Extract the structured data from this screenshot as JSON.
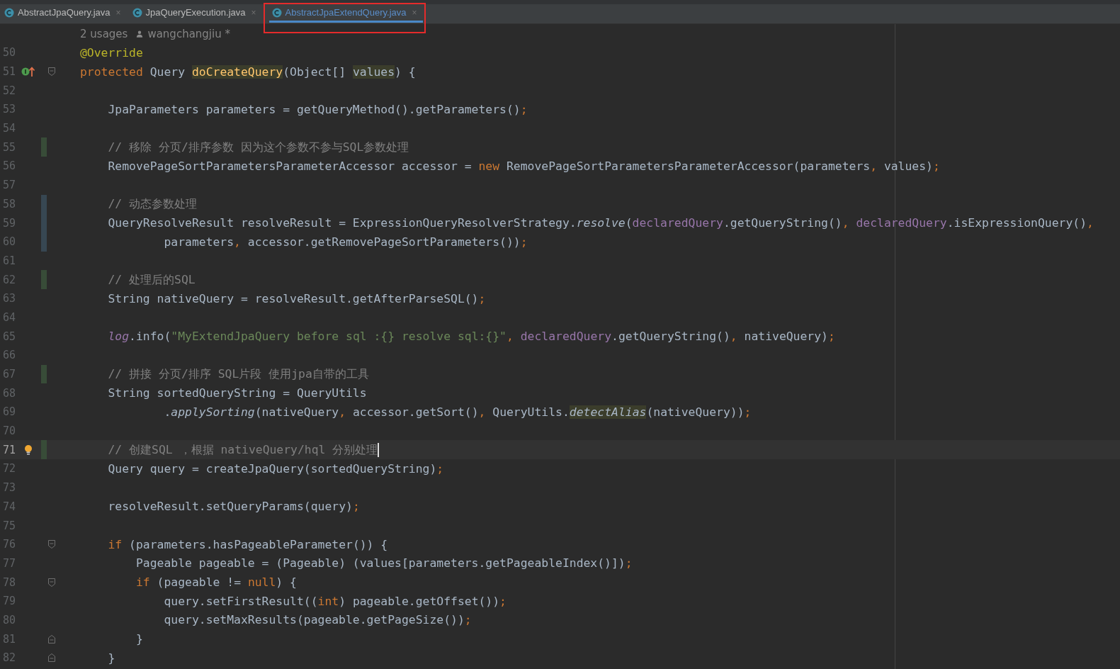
{
  "tabs": [
    {
      "label": "AbstractJpaQuery.java",
      "close": "×",
      "selected": false,
      "annotated": false
    },
    {
      "label": "JpaQueryExecution.java",
      "close": "×",
      "selected": false,
      "annotated": false
    },
    {
      "label": "AbstractJpaExtendQuery.java",
      "close": "×",
      "selected": true,
      "annotated": true
    }
  ],
  "editor": {
    "inlay": {
      "usages": "2 usages",
      "author": "wangchangjiu *"
    },
    "lines": [
      {
        "number": "50",
        "current": false,
        "tokens": [
          {
            "text": "@Override",
            "kind": "ann"
          }
        ]
      },
      {
        "number": "51",
        "current": false,
        "gutter_icon": {
          "kind": "override"
        },
        "fold": {
          "kind": "start"
        },
        "tokens": [
          {
            "text": "protected",
            "kind": "kw"
          },
          {
            "text": " Query ",
            "kind": "plain"
          },
          {
            "text": "doCreateQuery",
            "kind": "decl-hl"
          },
          {
            "text": "(Object[] ",
            "kind": "plain"
          },
          {
            "text": "values",
            "kind": "param-hl"
          },
          {
            "text": ") {",
            "kind": "plain"
          }
        ]
      },
      {
        "number": "52",
        "current": false
      },
      {
        "number": "53",
        "current": false,
        "tokens": [
          {
            "text": "    JpaParameters parameters = getQueryMethod().getParameters()",
            "kind": "plain"
          },
          {
            "text": ";",
            "kind": "punct"
          }
        ]
      },
      {
        "number": "54",
        "current": false
      },
      {
        "number": "55",
        "current": false,
        "change": {
          "kind": "added"
        },
        "tokens": [
          {
            "text": "    // 移除 分页/排序参数 因为这个参数不参与SQL参数处理",
            "kind": "cmt"
          }
        ]
      },
      {
        "number": "56",
        "current": false,
        "tokens": [
          {
            "text": "    RemovePageSortParametersParameterAccessor accessor = ",
            "kind": "plain"
          },
          {
            "text": "new",
            "kind": "kw"
          },
          {
            "text": " RemovePageSortParametersParameterAccessor(parameters",
            "kind": "plain"
          },
          {
            "text": ",",
            "kind": "punct"
          },
          {
            "text": " values)",
            "kind": "plain"
          },
          {
            "text": ";",
            "kind": "punct"
          }
        ]
      },
      {
        "number": "57",
        "current": false
      },
      {
        "number": "58",
        "current": false,
        "change": {
          "kind": "modified"
        },
        "tokens": [
          {
            "text": "    // 动态参数处理",
            "kind": "cmt"
          }
        ]
      },
      {
        "number": "59",
        "current": false,
        "change": {
          "kind": "modified"
        },
        "tokens": [
          {
            "text": "    QueryResolveResult resolveResult = ExpressionQueryResolverStrategy.",
            "kind": "plain"
          },
          {
            "text": "resolve",
            "kind": "static"
          },
          {
            "text": "(",
            "kind": "plain"
          },
          {
            "text": "declaredQuery",
            "kind": "field"
          },
          {
            "text": ".getQueryString()",
            "kind": "plain"
          },
          {
            "text": ",",
            "kind": "punct"
          },
          {
            "text": " declaredQuery",
            "kind": "field"
          },
          {
            "text": ".isExpressionQuery()",
            "kind": "plain"
          },
          {
            "text": ",",
            "kind": "punct"
          }
        ]
      },
      {
        "number": "60",
        "current": false,
        "change": {
          "kind": "modified"
        },
        "tokens": [
          {
            "text": "            parameters",
            "kind": "plain"
          },
          {
            "text": ",",
            "kind": "punct"
          },
          {
            "text": " accessor.getRemovePageSortParameters())",
            "kind": "plain"
          },
          {
            "text": ";",
            "kind": "punct"
          }
        ]
      },
      {
        "number": "61",
        "current": false
      },
      {
        "number": "62",
        "current": false,
        "change": {
          "kind": "added"
        },
        "tokens": [
          {
            "text": "    // 处理后的SQL",
            "kind": "cmt"
          }
        ]
      },
      {
        "number": "63",
        "current": false,
        "tokens": [
          {
            "text": "    String nativeQuery = resolveResult.getAfterParseSQL()",
            "kind": "plain"
          },
          {
            "text": ";",
            "kind": "punct"
          }
        ]
      },
      {
        "number": "64",
        "current": false
      },
      {
        "number": "65",
        "current": false,
        "tokens": [
          {
            "text": "    log",
            "kind": "static-field"
          },
          {
            "text": ".info(",
            "kind": "plain"
          },
          {
            "text": "\"MyExtendJpaQuery before sql :{} resolve sql:{}\"",
            "kind": "str"
          },
          {
            "text": ",",
            "kind": "punct"
          },
          {
            "text": " declaredQuery",
            "kind": "field"
          },
          {
            "text": ".getQueryString()",
            "kind": "plain"
          },
          {
            "text": ",",
            "kind": "punct"
          },
          {
            "text": " nativeQuery)",
            "kind": "plain"
          },
          {
            "text": ";",
            "kind": "punct"
          }
        ]
      },
      {
        "number": "66",
        "current": false
      },
      {
        "number": "67",
        "current": false,
        "change": {
          "kind": "added"
        },
        "tokens": [
          {
            "text": "    // 拼接 分页/排序 SQL片段 使用jpa自带的工具",
            "kind": "cmt"
          }
        ]
      },
      {
        "number": "68",
        "current": false,
        "tokens": [
          {
            "text": "    String sortedQueryString = QueryUtils",
            "kind": "plain"
          }
        ]
      },
      {
        "number": "69",
        "current": false,
        "tokens": [
          {
            "text": "            .",
            "kind": "plain"
          },
          {
            "text": "applySorting",
            "kind": "static"
          },
          {
            "text": "(nativeQuery",
            "kind": "plain"
          },
          {
            "text": ",",
            "kind": "punct"
          },
          {
            "text": " accessor.getSort()",
            "kind": "plain"
          },
          {
            "text": ",",
            "kind": "punct"
          },
          {
            "text": " QueryUtils.",
            "kind": "plain"
          },
          {
            "text": "detectAlias",
            "kind": "static-hl"
          },
          {
            "text": "(nativeQuery))",
            "kind": "plain"
          },
          {
            "text": ";",
            "kind": "punct"
          }
        ]
      },
      {
        "number": "70",
        "current": false
      },
      {
        "number": "71",
        "current": true,
        "change": {
          "kind": "added"
        },
        "gutter_icon": {
          "kind": "bulb"
        },
        "tokens": [
          {
            "text": "    // 创建SQL ，根据 nativeQuery/hql 分别处理",
            "kind": "cmt"
          }
        ]
      },
      {
        "number": "72",
        "current": false,
        "tokens": [
          {
            "text": "    Query query = createJpaQuery(sortedQueryString)",
            "kind": "plain"
          },
          {
            "text": ";",
            "kind": "punct"
          }
        ]
      },
      {
        "number": "73",
        "current": false
      },
      {
        "number": "74",
        "current": false,
        "tokens": [
          {
            "text": "    resolveResult.setQueryParams(query)",
            "kind": "plain"
          },
          {
            "text": ";",
            "kind": "punct"
          }
        ]
      },
      {
        "number": "75",
        "current": false
      },
      {
        "number": "76",
        "current": false,
        "fold": {
          "kind": "start"
        },
        "tokens": [
          {
            "text": "    if",
            "kind": "kw"
          },
          {
            "text": " (parameters.hasPageableParameter()) {",
            "kind": "plain"
          }
        ]
      },
      {
        "number": "77",
        "current": false,
        "tokens": [
          {
            "text": "        Pageable pageable = (Pageable) (values[parameters.getPageableIndex()])",
            "kind": "plain"
          },
          {
            "text": ";",
            "kind": "punct"
          }
        ]
      },
      {
        "number": "78",
        "current": false,
        "fold": {
          "kind": "start"
        },
        "tokens": [
          {
            "text": "        if",
            "kind": "kw"
          },
          {
            "text": " (pageable != ",
            "kind": "plain"
          },
          {
            "text": "null",
            "kind": "kw"
          },
          {
            "text": ") {",
            "kind": "plain"
          }
        ]
      },
      {
        "number": "79",
        "current": false,
        "tokens": [
          {
            "text": "            query.setFirstResult((",
            "kind": "plain"
          },
          {
            "text": "int",
            "kind": "kw"
          },
          {
            "text": ") pageable.getOffset())",
            "kind": "plain"
          },
          {
            "text": ";",
            "kind": "punct"
          }
        ]
      },
      {
        "number": "80",
        "current": false,
        "tokens": [
          {
            "text": "            query.setMaxResults(pageable.getPageSize())",
            "kind": "plain"
          },
          {
            "text": ";",
            "kind": "punct"
          }
        ]
      },
      {
        "number": "81",
        "current": false,
        "fold": {
          "kind": "end"
        },
        "tokens": [
          {
            "text": "        }",
            "kind": "plain"
          }
        ]
      },
      {
        "number": "82",
        "current": false,
        "fold": {
          "kind": "end"
        },
        "tokens": [
          {
            "text": "    }",
            "kind": "plain"
          }
        ]
      }
    ]
  }
}
